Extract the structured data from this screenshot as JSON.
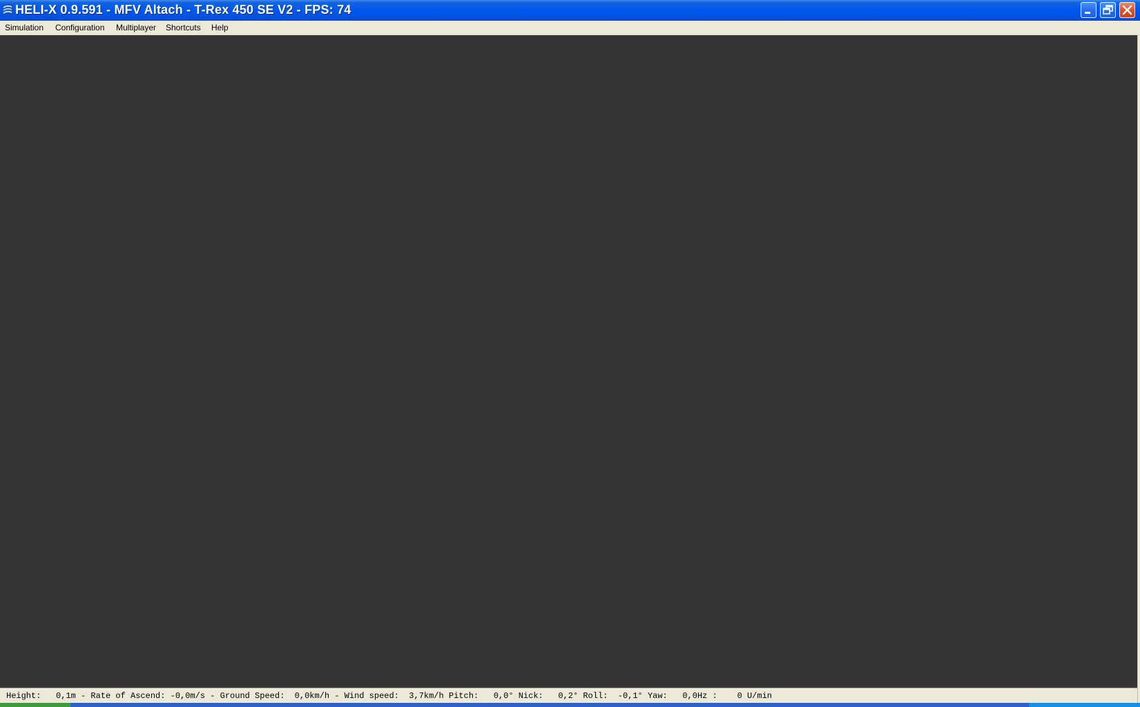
{
  "window": {
    "title": "HELI-X 0.9.591 - MFV Altach - T-Rex 450 SE V2 - FPS: 74",
    "icon": "heli-x-app-icon",
    "controls": [
      "minimize-icon",
      "restore-icon",
      "close-icon"
    ]
  },
  "menu": {
    "items": [
      {
        "label": "Simulation"
      },
      {
        "label": "Configuration"
      },
      {
        "label": "Multiplayer"
      },
      {
        "label": "Shortcuts"
      },
      {
        "label": "Help"
      }
    ]
  },
  "status": {
    "text": "Height:   0,1m - Rate of Ascend: -0,0m/s - Ground Speed:  0,0km/h - Wind speed:  3,7km/h Pitch:   0,0° Nick:   0,2° Roll:  -0,1° Yaw:   0,0Hz :    0 U/min"
  },
  "colors": {
    "titlebar": "#0058ee",
    "menubar": "#ece9d8",
    "viewport": "#333433",
    "statusbar": "#ece9d8",
    "close_button": "#e0522e"
  }
}
